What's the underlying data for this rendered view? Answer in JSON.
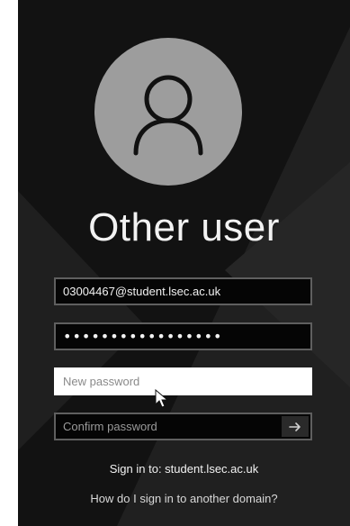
{
  "login": {
    "title": "Other user",
    "username_value": "03004467@student.lsec.ac.uk",
    "password_mask": "•••••••••••••••••",
    "new_password_placeholder": "New password",
    "confirm_password_placeholder": "Confirm password",
    "sign_in_to": "Sign in to: student.lsec.ac.uk",
    "other_domain_link": "How do I sign in to another domain?"
  },
  "icons": {
    "avatar": "user-silhouette-icon",
    "submit": "arrow-right-icon",
    "cursor": "mouse-pointer-icon"
  },
  "colors": {
    "background": "#121212",
    "avatar_circle": "#9d9d9d",
    "field_border": "#5f5f5f",
    "active_field": "#ffffff",
    "text": "#f2f2f2"
  }
}
